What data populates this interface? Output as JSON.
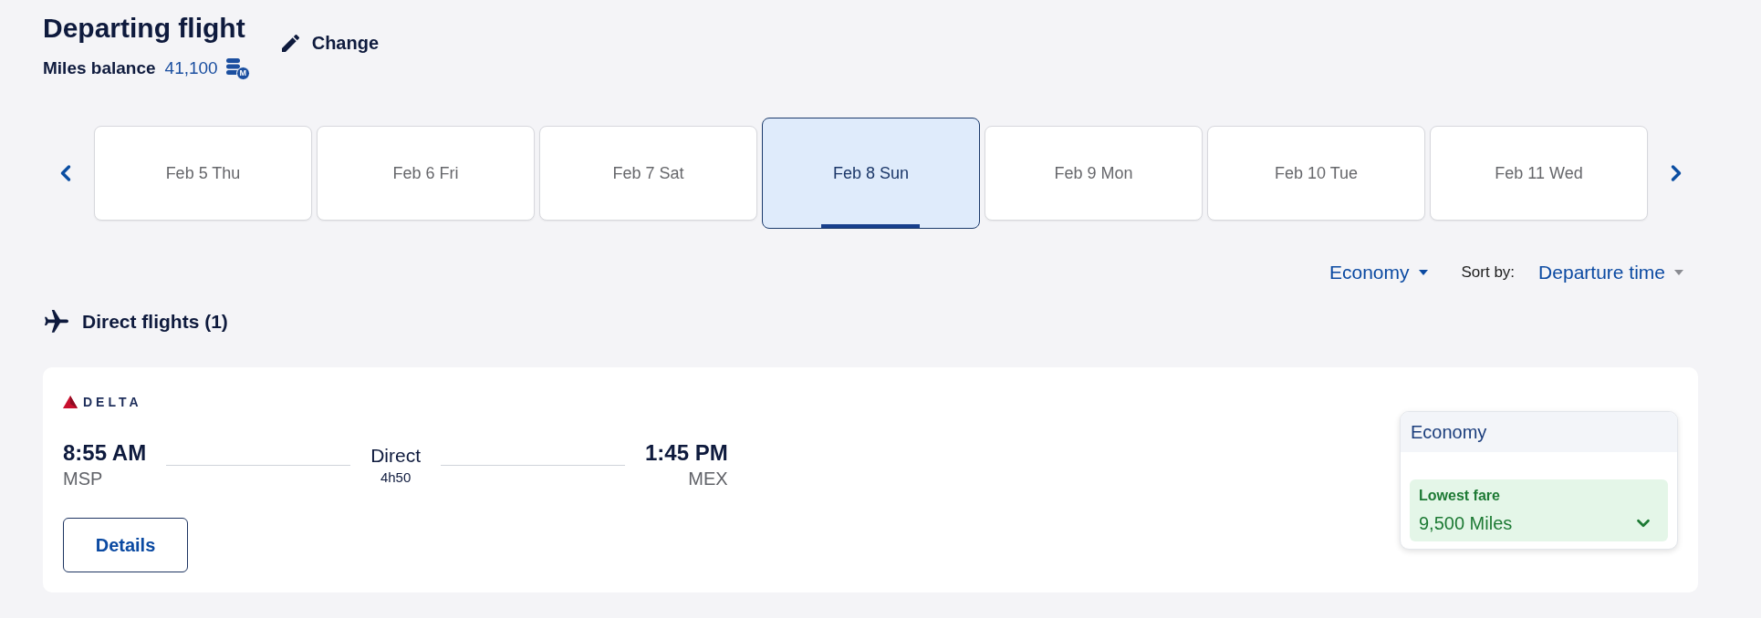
{
  "header": {
    "title": "Departing flight",
    "change_label": "Change",
    "balance_label": "Miles balance",
    "balance_value": "41,100",
    "balance_mark": "M"
  },
  "date_tabs": [
    {
      "label": "Feb 5 Thu",
      "selected": false
    },
    {
      "label": "Feb 6 Fri",
      "selected": false
    },
    {
      "label": "Feb 7 Sat",
      "selected": false
    },
    {
      "label": "Feb 8 Sun",
      "selected": true
    },
    {
      "label": "Feb 9 Mon",
      "selected": false
    },
    {
      "label": "Feb 10 Tue",
      "selected": false
    },
    {
      "label": "Feb 11 Wed",
      "selected": false
    }
  ],
  "filters": {
    "cabin": "Economy",
    "sort_label": "Sort by:",
    "sort_value": "Departure time"
  },
  "section": {
    "title": "Direct flights (1)"
  },
  "flights": [
    {
      "airline": "DELTA",
      "depart_time": "8:55 AM",
      "depart_airport": "MSP",
      "stops": "Direct",
      "duration": "4h50",
      "arrive_time": "1:45 PM",
      "arrive_airport": "MEX",
      "details_label": "Details",
      "fare": {
        "cabin": "Economy",
        "badge": "Lowest fare",
        "price": "9,500 Miles"
      }
    }
  ]
}
